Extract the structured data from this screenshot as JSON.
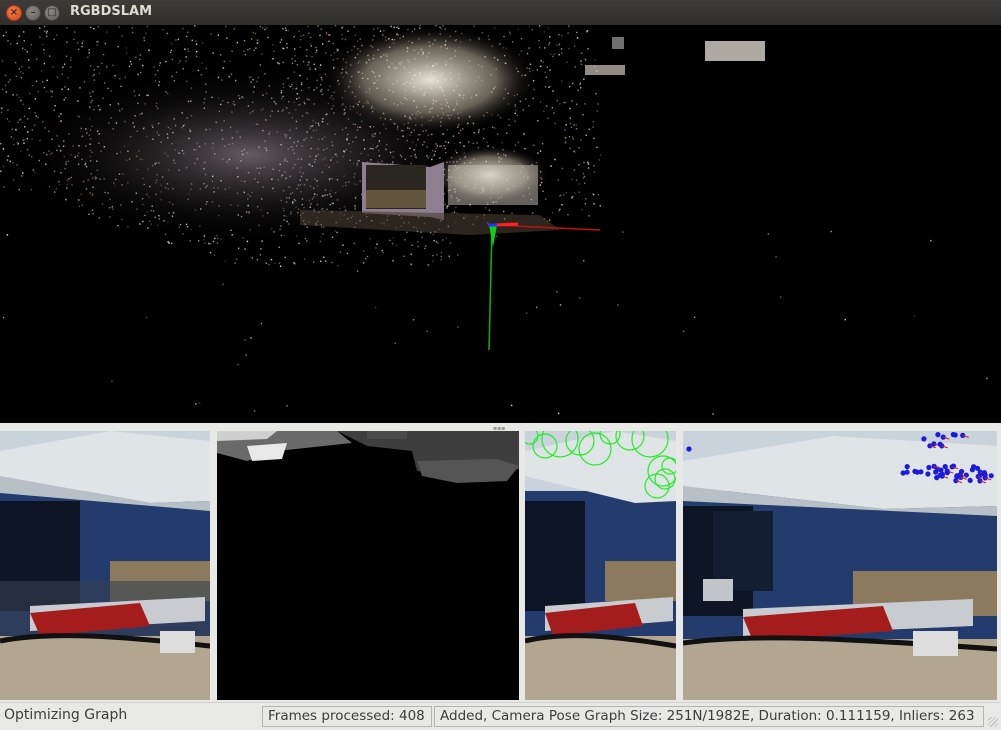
{
  "window": {
    "title": "RGBDSLAM",
    "buttons": {
      "close": "×",
      "minimize": "–",
      "maximize": "□"
    }
  },
  "views": {
    "cloud": "3d-point-cloud-view",
    "panels": [
      "rgb-image",
      "depth-image",
      "feature-image",
      "feature-flow-image"
    ]
  },
  "statusbar": {
    "message": "Optimizing Graph",
    "frames": "Frames processed: 408",
    "info": "Added, Camera Pose Graph Size: 251N/1982E, Duration: 0.111159, Inliers:  263"
  },
  "colors": {
    "titlebar": "#33322f",
    "close_button": "#dd4814",
    "feature_circles": "#22ee22",
    "flow_points": "#1a1ae0",
    "axis_red": "#e01010",
    "axis_green": "#10c010",
    "axis_blue": "#2030ff"
  }
}
